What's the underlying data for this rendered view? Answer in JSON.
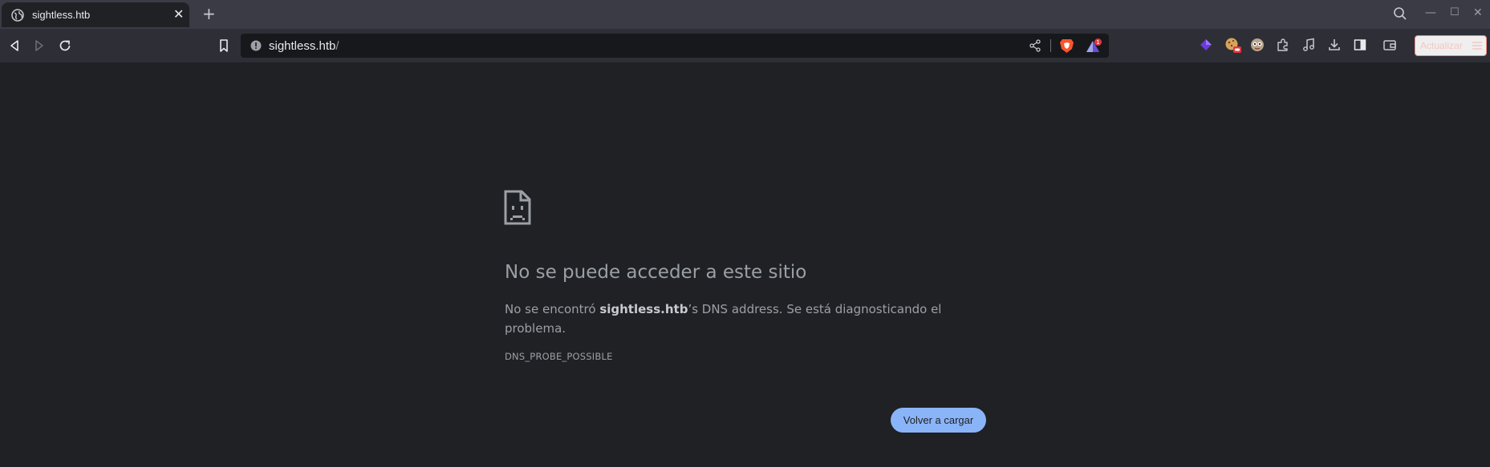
{
  "tab": {
    "title": "sightless.htb",
    "close_glyph": "✕"
  },
  "new_tab_glyph": "+",
  "window_controls": {
    "minimize": "—",
    "maximize": "☐",
    "close": "✕"
  },
  "omnibox": {
    "host": "sightless.htb",
    "path": "/"
  },
  "brave_alert_count": "1",
  "toolbar": {
    "update_label": "Actualizar"
  },
  "error": {
    "title": "No se puede acceder a este sitio",
    "desc_prefix": "No se encontró ",
    "desc_host": "sightless.htb",
    "desc_suffix": "’s DNS address. Se está diagnosticando el problema.",
    "code": "DNS_PROBE_POSSIBLE",
    "reload_label": "Volver a cargar"
  },
  "colors": {
    "page_bg": "#202124",
    "tabstrip_bg": "#3b3b45",
    "toolbar_bg": "#2d2e36",
    "button_blue": "#8ab4f8",
    "brave_orange": "#fb542b",
    "update_border": "#f28b82"
  },
  "icons": [
    "globe-icon",
    "search-icon",
    "back-icon",
    "forward-icon",
    "reload-icon",
    "bookmark-icon",
    "info-icon",
    "share-icon",
    "brave-shields-icon",
    "brave-rewards-icon",
    "extension-icon",
    "music-icon",
    "download-icon",
    "sidebar-icon",
    "wallet-icon",
    "menu-icon",
    "sad-page-icon"
  ]
}
